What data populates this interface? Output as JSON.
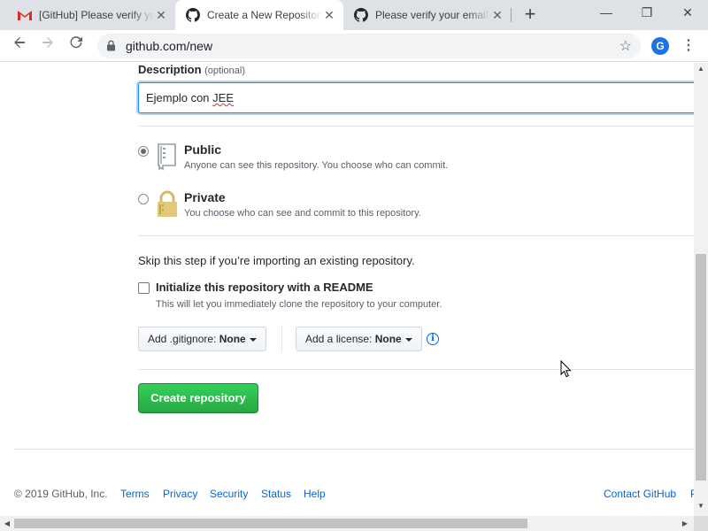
{
  "browser": {
    "tabs": [
      {
        "title": "[GitHub] Please verify your email",
        "icon": "gmail-icon",
        "active": false
      },
      {
        "title": "Create a New Repository",
        "icon": "github-icon",
        "active": true
      },
      {
        "title": "Please verify your email",
        "icon": "github-icon",
        "active": false
      }
    ],
    "tab_close_glyph": "✕",
    "new_tab_glyph": "+",
    "window_controls": {
      "minimize": "—",
      "maximize": "❐",
      "close": "✕"
    },
    "url": "github.com/new",
    "profile_initial": "G"
  },
  "form": {
    "description_label": "Description",
    "description_optional": "(optional)",
    "description_value_prefix": "Ejemplo con ",
    "description_value_misspelled": "JEE",
    "visibility": {
      "selected": "public",
      "public_title": "Public",
      "public_note": "Anyone can see this repository. You choose who can commit.",
      "private_title": "Private",
      "private_note": "You choose who can see and commit to this repository."
    },
    "skip_text": "Skip this step if you’re importing an existing repository.",
    "init_readme_label": "Initialize this repository with a README",
    "init_readme_checked": false,
    "init_readme_note": "This will let you immediately clone the repository to your computer.",
    "gitignore_label": "Add .gitignore:",
    "gitignore_value": "None",
    "license_label": "Add a license:",
    "license_value": "None",
    "create_button": "Create repository"
  },
  "footer": {
    "copyright": "© 2019 GitHub, Inc.",
    "links": [
      "Terms",
      "Privacy",
      "Security",
      "Status",
      "Help"
    ],
    "contact": "Contact GitHub",
    "cut_off_link": "P"
  },
  "colors": {
    "link": "#0366d6",
    "create_button": "#28a745",
    "focus_border": "#2188ff"
  }
}
